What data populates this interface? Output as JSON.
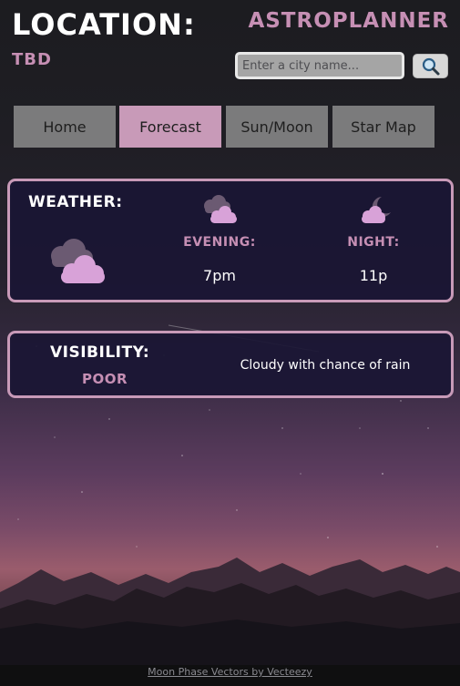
{
  "header": {
    "location_label": "LOCATION:",
    "location_value": "TBD",
    "app_title": "ASTROPLANNER"
  },
  "search": {
    "placeholder": "Enter a city name...",
    "value": "",
    "button_icon": "magnifier-icon"
  },
  "tabs": [
    {
      "label": "Home",
      "active": false
    },
    {
      "label": "Forecast",
      "active": true
    },
    {
      "label": "Sun/Moon",
      "active": false
    },
    {
      "label": "Star Map",
      "active": false
    }
  ],
  "weather": {
    "heading": "WEATHER:",
    "current_icon": "cloudy-icon",
    "periods": [
      {
        "label": "EVENING:",
        "time": "7pm",
        "icon": "cloudy-icon"
      },
      {
        "label": "NIGHT:",
        "time": "11p",
        "icon": "cloudy-night-icon"
      }
    ]
  },
  "visibility": {
    "heading": "VISIBILITY:",
    "value": "POOR",
    "description": "Cloudy with chance of rain"
  },
  "footer": {
    "credit_link": "Moon Phase Vectors by Vecteezy"
  },
  "colors": {
    "accent": "#c89ab8",
    "card_bg": "#1a1634",
    "tab_bg": "#7b7b7c"
  }
}
